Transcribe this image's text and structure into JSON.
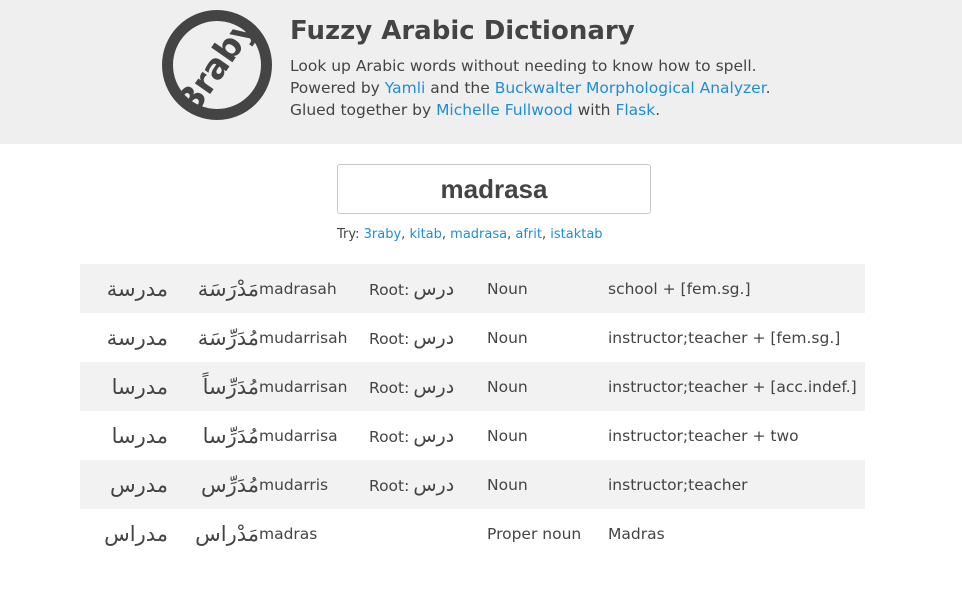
{
  "logo": {
    "text": "3raby"
  },
  "header": {
    "title": "Fuzzy Arabic Dictionary",
    "line1": "Look up Arabic words without needing to know how to spell.",
    "line2_pre": "Powered by ",
    "line2_link1": "Yamli",
    "line2_mid": " and the ",
    "line2_link2": "Buckwalter Morphological Analyzer",
    "line2_post": ".",
    "line3_pre": "Glued together by ",
    "line3_link1": "Michelle Fullwood",
    "line3_mid": " with ",
    "line3_link2": "Flask",
    "line3_post": "."
  },
  "search": {
    "value": "madrasa"
  },
  "try": {
    "label": "Try: ",
    "examples": [
      "3raby",
      "kitab",
      "madrasa",
      "afrit",
      "istaktab"
    ],
    "sep": ", "
  },
  "results": [
    {
      "arabic": "مدرسة",
      "vocalized": "مَدْرَسَة",
      "translit": "madrasah",
      "root_label": "Root:",
      "root": "درس",
      "pos": "Noun",
      "gloss": "school + [fem.sg.]"
    },
    {
      "arabic": "مدرسة",
      "vocalized": "مُدَرِّسَة",
      "translit": "mudarrisah",
      "root_label": "Root:",
      "root": "درس",
      "pos": "Noun",
      "gloss": "instructor;teacher + [fem.sg.]"
    },
    {
      "arabic": "مدرسا",
      "vocalized": "مُدَرِّساً",
      "translit": "mudarrisan",
      "root_label": "Root:",
      "root": "درس",
      "pos": "Noun",
      "gloss": "instructor;teacher + [acc.indef.]"
    },
    {
      "arabic": "مدرسا",
      "vocalized": "مُدَرِّسا",
      "translit": "mudarrisa",
      "root_label": "Root:",
      "root": "درس",
      "pos": "Noun",
      "gloss": "instructor;teacher + two"
    },
    {
      "arabic": "مدرس",
      "vocalized": "مُدَرِّس",
      "translit": "mudarris",
      "root_label": "Root:",
      "root": "درس",
      "pos": "Noun",
      "gloss": "instructor;teacher"
    },
    {
      "arabic": "مدراس",
      "vocalized": "مَدْراس",
      "translit": "madras",
      "root_label": "",
      "root": "",
      "pos": "Proper noun",
      "gloss": "Madras"
    }
  ]
}
